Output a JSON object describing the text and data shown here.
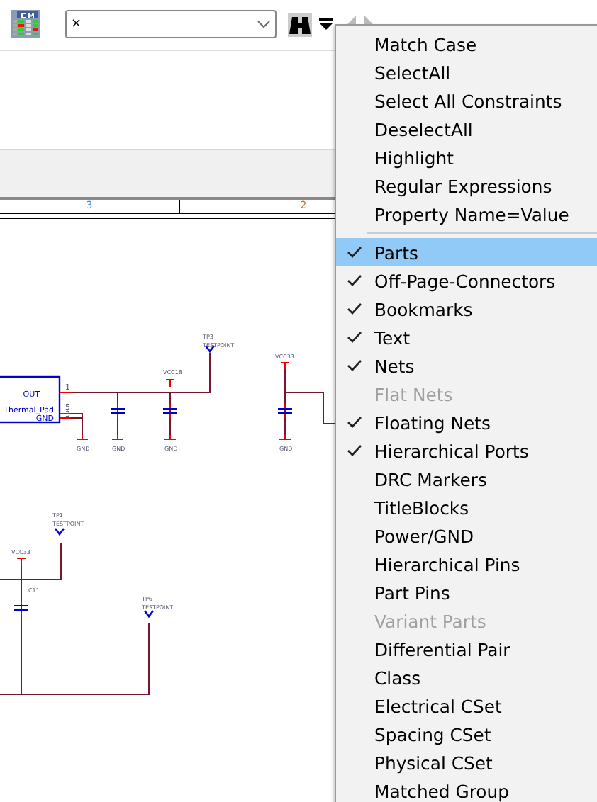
{
  "toolbar": {
    "search_field": {
      "value": "×"
    }
  },
  "sheet_border": {
    "zones": [
      "3",
      "2"
    ]
  },
  "schematic": {
    "labels": [
      {
        "text": "OUT"
      },
      {
        "text": "Thermal_Pad"
      },
      {
        "text": "GND"
      },
      {
        "text": "1"
      },
      {
        "text": "5"
      },
      {
        "text": "3"
      },
      {
        "text": "TP3"
      },
      {
        "text": "TESTPOINT"
      },
      {
        "text": "VCC18"
      },
      {
        "text": "VCC33"
      },
      {
        "text": "GND"
      },
      {
        "text": "GND"
      },
      {
        "text": "GND"
      },
      {
        "text": "GND"
      },
      {
        "text": "TP1"
      },
      {
        "text": "TESTPOINT"
      },
      {
        "text": "VCC33"
      },
      {
        "text": "C11"
      },
      {
        "text": "TP6"
      },
      {
        "text": "TESTPOINT"
      }
    ]
  },
  "menu": {
    "items": [
      {
        "kind": "command",
        "label": "Match Case"
      },
      {
        "kind": "command",
        "label": "SelectAll"
      },
      {
        "kind": "command",
        "label": "Select All Constraints"
      },
      {
        "kind": "command",
        "label": "DeselectAll"
      },
      {
        "kind": "command",
        "label": "Highlight"
      },
      {
        "kind": "command",
        "label": "Regular Expressions"
      },
      {
        "kind": "command",
        "label": "Property Name=Value"
      },
      {
        "kind": "separator"
      },
      {
        "kind": "filter",
        "label": "Parts",
        "checked": true,
        "disabled": false,
        "selected": true
      },
      {
        "kind": "filter",
        "label": "Off-Page-Connectors",
        "checked": true,
        "disabled": false,
        "selected": false
      },
      {
        "kind": "filter",
        "label": "Bookmarks",
        "checked": true,
        "disabled": false,
        "selected": false
      },
      {
        "kind": "filter",
        "label": "Text",
        "checked": true,
        "disabled": false,
        "selected": false
      },
      {
        "kind": "filter",
        "label": "Nets",
        "checked": true,
        "disabled": false,
        "selected": false
      },
      {
        "kind": "filter",
        "label": "Flat Nets",
        "checked": false,
        "disabled": true,
        "selected": false
      },
      {
        "kind": "filter",
        "label": "Floating Nets",
        "checked": true,
        "disabled": false,
        "selected": false
      },
      {
        "kind": "filter",
        "label": "Hierarchical Ports",
        "checked": true,
        "disabled": false,
        "selected": false
      },
      {
        "kind": "filter",
        "label": "DRC Markers",
        "checked": false,
        "disabled": false,
        "selected": false
      },
      {
        "kind": "filter",
        "label": "TitleBlocks",
        "checked": false,
        "disabled": false,
        "selected": false
      },
      {
        "kind": "filter",
        "label": "Power/GND",
        "checked": false,
        "disabled": false,
        "selected": false
      },
      {
        "kind": "filter",
        "label": "Hierarchical Pins",
        "checked": false,
        "disabled": false,
        "selected": false
      },
      {
        "kind": "filter",
        "label": "Part Pins",
        "checked": false,
        "disabled": false,
        "selected": false
      },
      {
        "kind": "filter",
        "label": "Variant Parts",
        "checked": false,
        "disabled": true,
        "selected": false
      },
      {
        "kind": "filter",
        "label": "Differential Pair",
        "checked": false,
        "disabled": false,
        "selected": false
      },
      {
        "kind": "filter",
        "label": "Class",
        "checked": false,
        "disabled": false,
        "selected": false
      },
      {
        "kind": "filter",
        "label": "Electrical CSet",
        "checked": false,
        "disabled": false,
        "selected": false
      },
      {
        "kind": "filter",
        "label": "Spacing CSet",
        "checked": false,
        "disabled": false,
        "selected": false
      },
      {
        "kind": "filter",
        "label": "Physical CSet",
        "checked": false,
        "disabled": false,
        "selected": false
      },
      {
        "kind": "filter",
        "label": "Matched Group",
        "checked": false,
        "disabled": false,
        "selected": false
      }
    ]
  }
}
